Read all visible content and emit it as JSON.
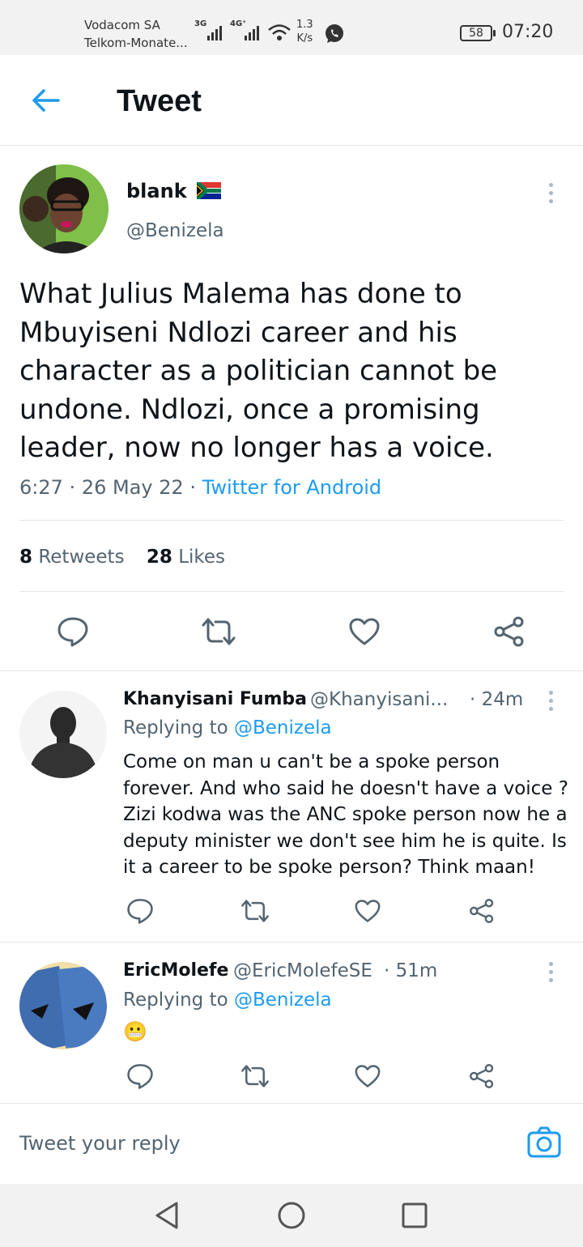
{
  "status": {
    "carrier_line1": "Vodacom SA",
    "carrier_line2": "Telkom-Monate...",
    "net1": "3G",
    "net2": "4G⁺",
    "speed_value": "1.3",
    "speed_unit": "K/s",
    "battery": "58",
    "time": "07:20"
  },
  "header": {
    "title": "Tweet"
  },
  "tweet": {
    "name": "blank",
    "flag": "🇿🇦",
    "handle": "@Benizela",
    "text": "What Julius Malema has done to Mbuyiseni Ndlozi career and his character as a politician cannot be undone. Ndlozi, once a promising leader, now no longer has a voice.",
    "time": "6:27",
    "date": "26 May 22",
    "source": "Twitter for Android",
    "retweets_count": "8",
    "retweets_label": "Retweets",
    "likes_count": "28",
    "likes_label": "Likes"
  },
  "replies": [
    {
      "name": "Khanyisani Fumba",
      "handle": "@Khanyisani...",
      "age": "· 24m",
      "replying_prefix": "Replying to",
      "replying_to": "@Benizela",
      "text": "Come on man u can't be a spoke person forever. And who said he doesn't have a voice ? Zizi kodwa was the ANC spoke person now he a deputy minister we don't see him he is quite. Is it a career to be spoke person? Think maan!"
    },
    {
      "name": "EricMolefe",
      "handle": "@EricMolefeSE",
      "age": "· 51m",
      "replying_prefix": "Replying to",
      "replying_to": "@Benizela",
      "text": "😬"
    }
  ],
  "reply_bar": {
    "placeholder": "Tweet your reply"
  },
  "colors": {
    "accent": "#1d9bf0",
    "text": "#0f1419",
    "muted": "#536471",
    "divider": "#e1e6ea"
  },
  "icons": [
    "back-arrow-icon",
    "more-icon",
    "reply-icon",
    "retweet-icon",
    "like-icon",
    "share-icon",
    "camera-icon",
    "nav-back-icon",
    "nav-home-icon",
    "nav-recents-icon"
  ]
}
